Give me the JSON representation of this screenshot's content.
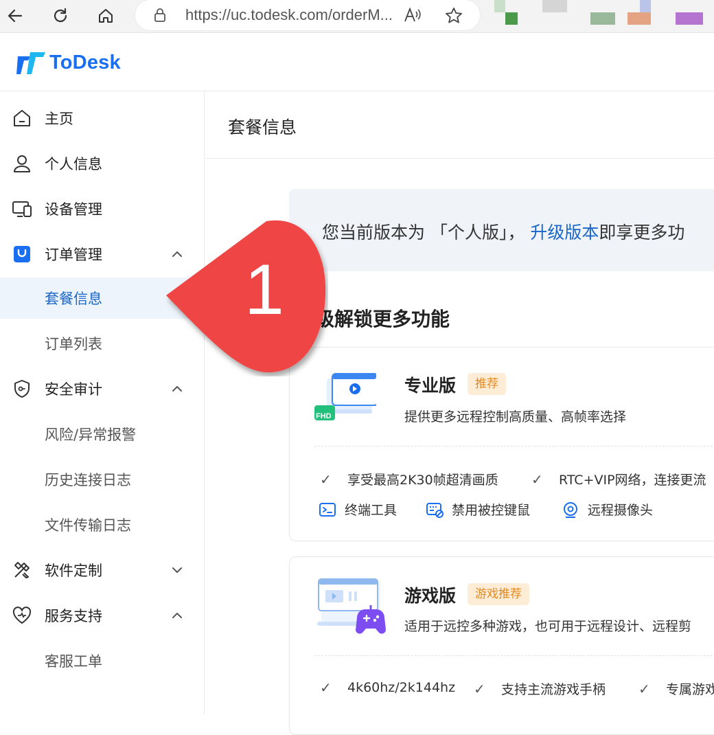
{
  "browser": {
    "url": "https://uc.todesk.com/orderM..."
  },
  "site": {
    "logo_text": "ToDesk"
  },
  "sidebar": {
    "items": [
      {
        "label": "主页"
      },
      {
        "label": "个人信息"
      },
      {
        "label": "设备管理"
      },
      {
        "label": "订单管理"
      },
      {
        "label": "套餐信息"
      },
      {
        "label": "订单列表"
      },
      {
        "label": "安全审计"
      },
      {
        "label": "风险/异常报警"
      },
      {
        "label": "历史连接日志"
      },
      {
        "label": "文件传输日志"
      },
      {
        "label": "软件定制"
      },
      {
        "label": "服务支持"
      },
      {
        "label": "客服工单"
      }
    ]
  },
  "main": {
    "page_title": "套餐信息",
    "banner": {
      "prefix": "您当前版本为 「个人版」，",
      "link": "升级版本",
      "suffix": "即享更多功"
    },
    "section_title": "级解锁更多功能",
    "plans": [
      {
        "name": "专业版",
        "tag": "推荐",
        "icon_badge": "FHD",
        "description": "提供更多远程控制高质量、高帧率选择",
        "checks": [
          "享受最高2K30帧超清画质",
          "RTC+VIP网络，连接更流"
        ],
        "features": [
          "终端工具",
          "禁用被控键鼠",
          "远程摄像头"
        ]
      },
      {
        "name": "游戏版",
        "tag": "游戏推荐",
        "description": "适用于远控多种游戏，也可用于远程设计、远程剪",
        "checks": [
          "4k60hz/2k144hz",
          "支持主流游戏手柄",
          "专属游戏"
        ]
      }
    ]
  },
  "annotation": {
    "number": "1",
    "color": "#f04545"
  },
  "colors": {
    "brand": "#1a6ff0",
    "link": "#1a66c9",
    "active_bg": "#eef4fb",
    "tag_bg": "#fdecd6",
    "tag_fg": "#e58a1f"
  }
}
